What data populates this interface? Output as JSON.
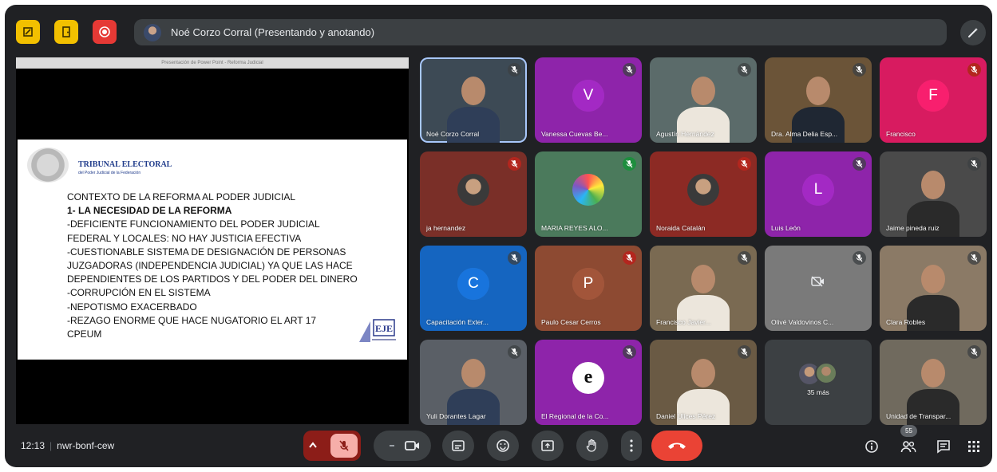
{
  "presenter": {
    "label": "Noé Corzo Corral (Presentando y anotando)"
  },
  "screen": {
    "window_title": "Presentación de Power Point - Reforma Judicial",
    "tribunal_title": "TRIBUNAL ELECTORAL",
    "tribunal_subtitle": "del Poder Judicial de la Federación",
    "slide_lines": [
      "CONTEXTO DE LA REFORMA AL PODER JUDICIAL",
      "1- LA NECESIDAD DE LA REFORMA",
      "-DEFICIENTE FUNCIONAMIENTO DEL PODER JUDICIAL",
      "FEDERAL Y LOCALES: NO HAY JUSTICIA EFECTIVA",
      "-CUESTIONABLE SISTEMA DE DESIGNACIÓN DE PERSONAS",
      "JUZGADORAS (INDEPENDENCIA JUDICIAL) YA QUE LAS HACE",
      "DEPENDIENTES DE LOS PARTIDOS Y DEL PODER DEL DINERO",
      "-CORRUPCIÓN EN EL SISTEMA",
      "-NEPOTISMO EXACERBADO",
      "-REZAGO ENORME QUE HACE NUGATORIO EL ART 17",
      "CPEUM"
    ],
    "logo_text": "EJE"
  },
  "participants": [
    {
      "name": "Noé Corzo Corral",
      "type": "video"
    },
    {
      "name": "Vanessa Cuevas Be...",
      "type": "letter",
      "letter": "V",
      "color": "#8e24aa"
    },
    {
      "name": "Agustín Hernández",
      "type": "video"
    },
    {
      "name": "Dra. Alma Delia Esp...",
      "type": "video"
    },
    {
      "name": "Francisco",
      "type": "letter",
      "letter": "F",
      "color": "#d81b60"
    },
    {
      "name": "ja hernandez",
      "type": "photo"
    },
    {
      "name": "MARIA REYES ALO...",
      "type": "photo"
    },
    {
      "name": "Noraida Catalán",
      "type": "photo"
    },
    {
      "name": "Luis León",
      "type": "letter",
      "letter": "L",
      "color": "#8e24aa"
    },
    {
      "name": "Jaime pineda ruiz",
      "type": "video"
    },
    {
      "name": "Capacitación Exter...",
      "type": "letter",
      "letter": "C",
      "color": "#1565c0"
    },
    {
      "name": "Paulo Cesar Cerros",
      "type": "letter",
      "letter": "P",
      "color": "#8d4a32"
    },
    {
      "name": "Francisco Javier...",
      "type": "video"
    },
    {
      "name": "Olivé Valdovinos C...",
      "type": "camera-off"
    },
    {
      "name": "Clara Robles",
      "type": "video"
    },
    {
      "name": "Yuli Dorantes Lagar",
      "type": "video"
    },
    {
      "name": "El Regional de la Co...",
      "type": "logo",
      "letter": "e"
    },
    {
      "name": "Daniel Ulices Pérez",
      "type": "video"
    },
    {
      "name": "35 más",
      "type": "more"
    },
    {
      "name": "Unidad de Transpar...",
      "type": "video"
    }
  ],
  "bottom": {
    "time": "12:13",
    "meeting_code": "nwr-bonf-cew",
    "participant_count": "55"
  },
  "colors": {
    "background": "#202124",
    "accent": "#ea4335",
    "bar": "#3c4043"
  }
}
